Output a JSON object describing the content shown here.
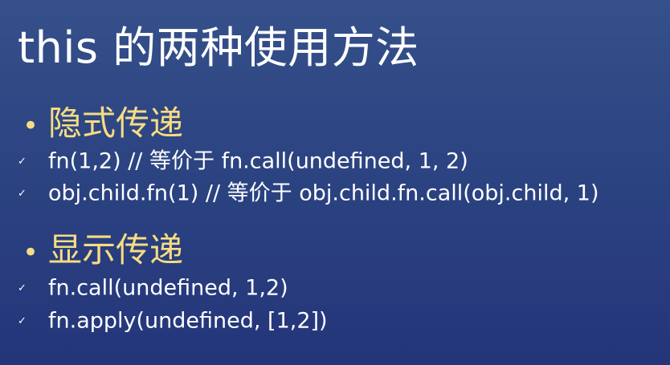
{
  "title": "this 的两种使用方法",
  "sections": [
    {
      "heading": "隐式传递",
      "bullet": "•",
      "items": [
        "fn(1,2) // 等价于 fn.call(undefined, 1, 2)",
        "obj.child.fn(1) // 等价于 obj.child.fn.call(obj.child, 1)"
      ]
    },
    {
      "heading": "显示传递",
      "bullet": "•",
      "items": [
        "fn.call(undefined, 1,2)",
        "fn.apply(undefined, [1,2])"
      ]
    }
  ],
  "check_glyph": "✓",
  "colors": {
    "background_top": "#35508a",
    "background_bottom": "#24357a",
    "heading": "#f7dc83",
    "text": "#ffffff"
  }
}
